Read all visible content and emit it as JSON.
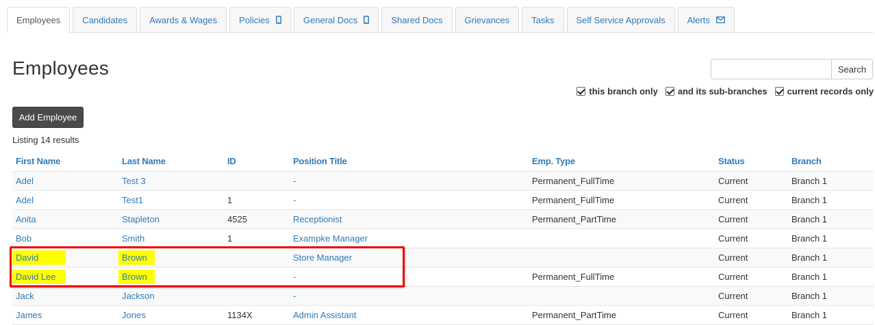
{
  "tabs": [
    {
      "label": "Employees",
      "icon": ""
    },
    {
      "label": "Candidates",
      "icon": ""
    },
    {
      "label": "Awards & Wages",
      "icon": ""
    },
    {
      "label": "Policies",
      "icon": "mobile-icon"
    },
    {
      "label": "General Docs",
      "icon": "mobile-icon"
    },
    {
      "label": "Shared Docs",
      "icon": ""
    },
    {
      "label": "Grievances",
      "icon": ""
    },
    {
      "label": "Tasks",
      "icon": ""
    },
    {
      "label": "Self Service Approvals",
      "icon": ""
    },
    {
      "label": "Alerts",
      "icon": "envelope-icon"
    }
  ],
  "page": {
    "title": "Employees",
    "listing": "Listing 14 results"
  },
  "search": {
    "value": "",
    "button_label": "Search"
  },
  "filters": {
    "this_branch": "this branch only",
    "sub_branches": "and its sub-branches",
    "current_records": "current records only"
  },
  "actions": {
    "add_employee": "Add Employee"
  },
  "table": {
    "headers": [
      "First Name",
      "Last Name",
      "ID",
      "Position Title",
      "Emp. Type",
      "Status",
      "Branch"
    ],
    "rows": [
      [
        "Adel",
        "Test 3",
        "",
        "-",
        "Permanent_FullTime",
        "Current",
        "Branch 1"
      ],
      [
        "Adel",
        "Test1",
        "1",
        "-",
        "Permanent_FullTime",
        "Current",
        "Branch 1"
      ],
      [
        "Anita",
        "Stapleton",
        "4525",
        "Receptionist",
        "Permanent_PartTime",
        "Current",
        "Branch 1"
      ],
      [
        "Bob",
        "Smith",
        "1",
        "Exampke Manager",
        "",
        "Current",
        "Branch 1"
      ],
      [
        "David",
        "Brown",
        "",
        "Store Manager",
        "",
        "Current",
        "Branch 1"
      ],
      [
        "David Lee",
        "Brown",
        "",
        "-",
        "Permanent_FullTime",
        "Current",
        "Branch 1"
      ],
      [
        "Jack",
        "Jackson",
        "",
        "-",
        "",
        "Current",
        "Branch 1"
      ],
      [
        "James",
        "Jones",
        "1134X",
        "Admin Assistant",
        "Permanent_PartTime",
        "Current",
        "Branch 1"
      ]
    ]
  },
  "colors": {
    "link": "#337ab7",
    "highlight": "#ffff00",
    "annotation": "#ee0000"
  }
}
